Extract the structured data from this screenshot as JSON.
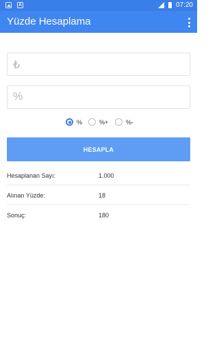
{
  "status_bar": {
    "time": "07:20",
    "icons": [
      "image-notification-icon",
      "a-notification-icon",
      "signal-icon",
      "battery-icon"
    ]
  },
  "app_bar": {
    "title": "Yüzde Hesaplama",
    "menu_icon": "overflow-menu-icon"
  },
  "inputs": {
    "amount": {
      "prefix": "₺",
      "value": "",
      "placeholder": ""
    },
    "percent": {
      "prefix": "%",
      "value": "",
      "placeholder": ""
    }
  },
  "options": [
    {
      "label": "%",
      "checked": true
    },
    {
      "label": "%+",
      "checked": false
    },
    {
      "label": "%-",
      "checked": false
    }
  ],
  "calculate_button": {
    "label": "HESAPLA"
  },
  "results": [
    {
      "label": "Hesaplanan Sayı:",
      "value": "1.000"
    },
    {
      "label": "Alınan Yüzde:",
      "value": "18"
    },
    {
      "label": "Sonuç:",
      "value": "180"
    }
  ],
  "colors": {
    "status_bar": "#3a7ee8",
    "app_bar": "#3f86f0",
    "button": "#5e9df3",
    "accent": "#3a7ee8"
  }
}
